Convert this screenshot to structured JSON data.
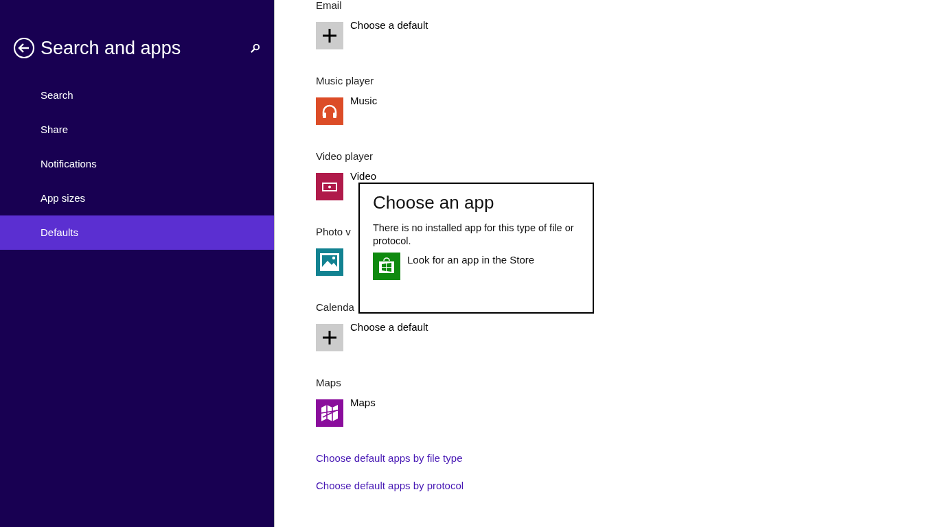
{
  "sidebar": {
    "title": "Search and apps",
    "items": [
      {
        "label": "Search",
        "selected": false
      },
      {
        "label": "Share",
        "selected": false
      },
      {
        "label": "Notifications",
        "selected": false
      },
      {
        "label": "App sizes",
        "selected": false
      },
      {
        "label": "Defaults",
        "selected": true
      }
    ]
  },
  "defaults": [
    {
      "label": "Email",
      "kind": "add",
      "app": "Choose a default"
    },
    {
      "label": "Music player",
      "kind": "headphones",
      "app": "Music"
    },
    {
      "label": "Video player",
      "kind": "video",
      "app": "Video"
    },
    {
      "label": "Photo v",
      "kind": "photo"
    },
    {
      "label": "Calenda",
      "kind": "add",
      "app": "Choose a default"
    },
    {
      "label": "Maps",
      "kind": "map",
      "app": "Maps"
    }
  ],
  "links": [
    "Choose default apps by file type",
    "Choose default apps by protocol"
  ],
  "popup": {
    "title": "Choose an app",
    "message": "There is no installed app for this type of file or protocol.",
    "action": "Look for an app in the Store"
  }
}
